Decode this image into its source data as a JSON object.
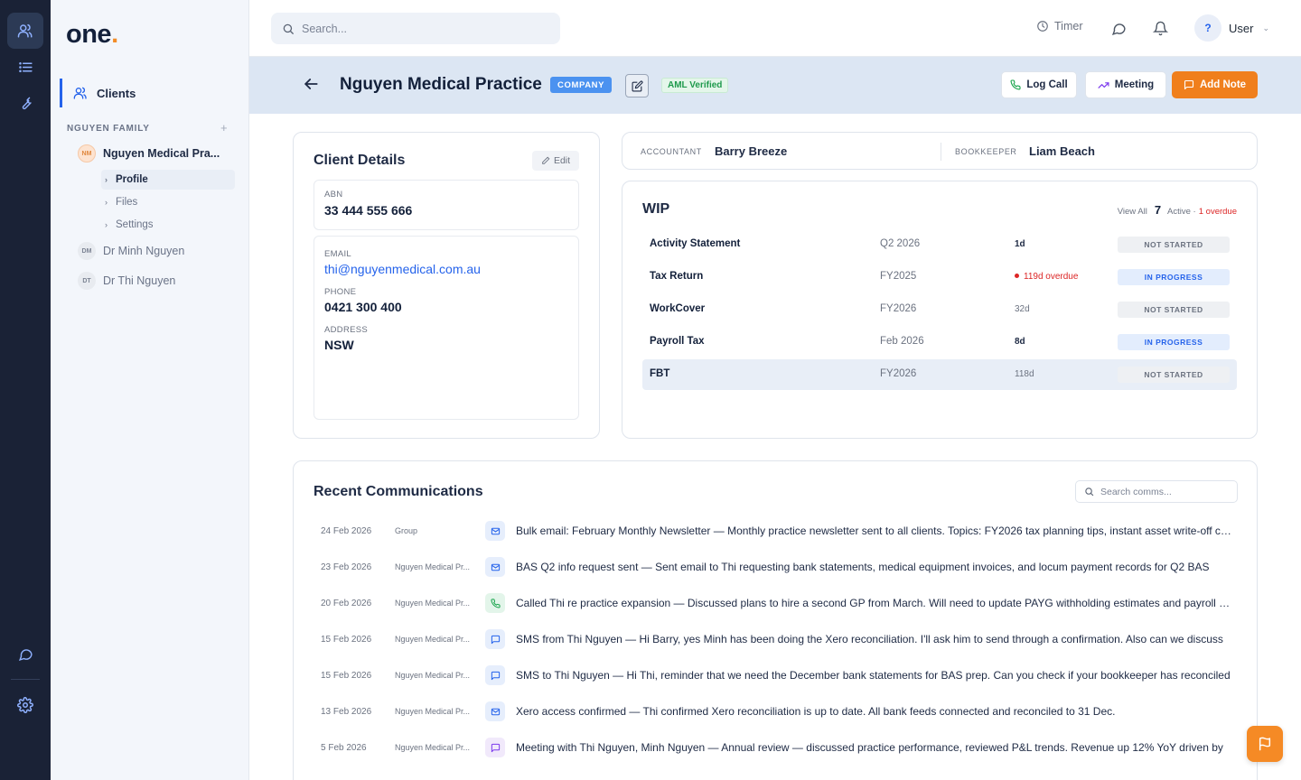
{
  "app": {
    "logo_text": "one",
    "logo_dot": ".",
    "accent": "#f07f1c",
    "primary": "#2563eb"
  },
  "rail": {
    "icons": [
      "users-icon",
      "list-icon",
      "wrench-icon",
      "chat-icon",
      "gear-icon"
    ]
  },
  "sidebar": {
    "nav_clients": "Clients",
    "group_title": "NGUYEN FAMILY",
    "group_add": "+",
    "clients": [
      {
        "initials": "NM",
        "name": "Nguyen Medical Pra..."
      },
      {
        "initials": "DM",
        "name": "Dr Minh Nguyen"
      },
      {
        "initials": "DT",
        "name": "Dr Thi Nguyen"
      }
    ],
    "sub_items": [
      "Profile",
      "Files",
      "Settings"
    ]
  },
  "topbar": {
    "search_placeholder": "Search...",
    "timer_label": "Timer",
    "user_initial": "?",
    "user_name": "User"
  },
  "header": {
    "title": "Nguyen Medical Practice",
    "company_badge": "COMPANY",
    "aml_badge": "AML Verified",
    "log_call": "Log Call",
    "meeting": "Meeting",
    "add_note": "Add Note"
  },
  "client_details": {
    "title": "Client Details",
    "edit": "Edit",
    "abn_label": "ABN",
    "abn": "33 444 555 666",
    "email_label": "EMAIL",
    "email": "thi@nguyenmedical.com.au",
    "phone_label": "PHONE",
    "phone": "0421 300 400",
    "address_label": "ADDRESS",
    "address": "NSW"
  },
  "staff": {
    "accountant_label": "ACCOUNTANT",
    "accountant": "Barry Breeze",
    "bookkeeper_label": "BOOKKEEPER",
    "bookkeeper": "Liam Beach"
  },
  "wip": {
    "title": "WIP",
    "view_all": "View All",
    "count": "7",
    "active": "Active ·",
    "overdue": "1 overdue",
    "rows": [
      {
        "name": "Activity Statement",
        "period": "Q2 2026",
        "due": "1d",
        "status": "NOT STARTED"
      },
      {
        "name": "Tax Return",
        "period": "FY2025",
        "due": "119d overdue",
        "status": "IN PROGRESS"
      },
      {
        "name": "WorkCover",
        "period": "FY2026",
        "due": "32d",
        "status": "NOT STARTED"
      },
      {
        "name": "Payroll Tax",
        "period": "Feb 2026",
        "due": "8d",
        "status": "IN PROGRESS"
      },
      {
        "name": "FBT",
        "period": "FY2026",
        "due": "118d",
        "status": "NOT STARTED"
      }
    ]
  },
  "comms": {
    "title": "Recent Communications",
    "search_placeholder": "Search comms...",
    "rows": [
      {
        "date": "24 Feb 2026",
        "who": "Group",
        "type": "mail",
        "text": "Bulk email: February Monthly Newsletter — Monthly practice newsletter sent to all clients. Topics: FY2026 tax planning tips, instant asset write-off changes"
      },
      {
        "date": "23 Feb 2026",
        "who": "Nguyen Medical Pr...",
        "type": "mail",
        "text": "BAS Q2 info request sent — Sent email to Thi requesting bank statements, medical equipment invoices, and locum payment records for Q2 BAS"
      },
      {
        "date": "20 Feb 2026",
        "who": "Nguyen Medical Pr...",
        "type": "phone",
        "text": "Called Thi re practice expansion — Discussed plans to hire a second GP from March. Will need to update PAYG withholding estimates and payroll tax"
      },
      {
        "date": "15 Feb 2026",
        "who": "Nguyen Medical Pr...",
        "type": "sms",
        "text": "SMS from Thi Nguyen — Hi Barry, yes Minh has been doing the Xero reconciliation. I'll ask him to send through a confirmation. Also can we discuss"
      },
      {
        "date": "15 Feb 2026",
        "who": "Nguyen Medical Pr...",
        "type": "sms",
        "text": "SMS to Thi Nguyen — Hi Thi, reminder that we need the December bank statements for BAS prep. Can you check if your bookkeeper has reconciled"
      },
      {
        "date": "13 Feb 2026",
        "who": "Nguyen Medical Pr...",
        "type": "mail",
        "text": "Xero access confirmed — Thi confirmed Xero reconciliation is up to date. All bank feeds connected and reconciled to 31 Dec."
      },
      {
        "date": "5 Feb 2026",
        "who": "Nguyen Medical Pr...",
        "type": "meet",
        "text": "Meeting with Thi Nguyen, Minh Nguyen — Annual review — discussed practice performance, reviewed P&L trends. Revenue up 12% YoY driven by"
      }
    ]
  }
}
